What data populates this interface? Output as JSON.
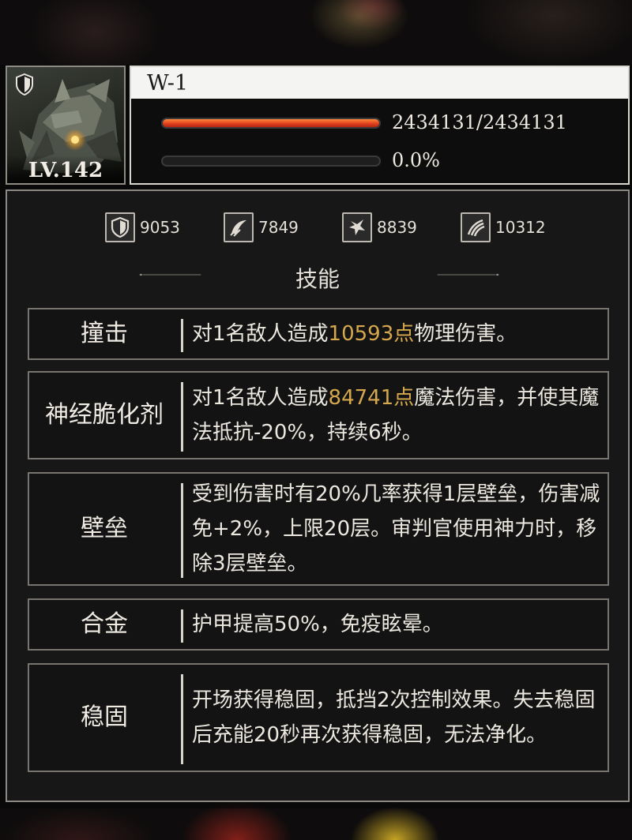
{
  "unit": {
    "name": "W-1",
    "level": "LV.142",
    "hp_text": "2434131/2434131",
    "hp_fraction": 1.0,
    "shield_text": "0.0%",
    "shield_fraction": 0.0,
    "class_icon": "shield-icon"
  },
  "stats": [
    {
      "icon": "armor-shield-icon",
      "value": "9053"
    },
    {
      "icon": "magic-resist-icon",
      "value": "7849"
    },
    {
      "icon": "attack-burst-icon",
      "value": "8839"
    },
    {
      "icon": "claw-swipe-icon",
      "value": "10312"
    }
  ],
  "section_title": "技能",
  "skills": [
    {
      "name": "撞击",
      "desc_before": "对1名敌人造成",
      "desc_highlight": "10593点",
      "desc_after": "物理伤害。"
    },
    {
      "name": "神经脆化剂",
      "desc_before": "对1名敌人造成",
      "desc_highlight": "84741点",
      "desc_after": "魔法伤害，并使其魔法抵抗-20%，持续6秒。"
    },
    {
      "name": "壁垒",
      "desc_before": "受到伤害时有20%几率获得1层壁垒，伤害减免+2%，上限20层。审判官使用神力时，移除3层壁垒。",
      "desc_highlight": "",
      "desc_after": ""
    },
    {
      "name": "合金",
      "desc_before": "护甲提高50%，免疫眩晕。",
      "desc_highlight": "",
      "desc_after": ""
    },
    {
      "name": "稳固",
      "desc_before": "开场获得稳固，抵挡2次控制效果。失去稳固后充能20秒再次获得稳固，无法净化。",
      "desc_highlight": "",
      "desc_after": ""
    }
  ],
  "colors": {
    "highlight": "#d6a84e",
    "hp_bar": "#e0411f"
  }
}
